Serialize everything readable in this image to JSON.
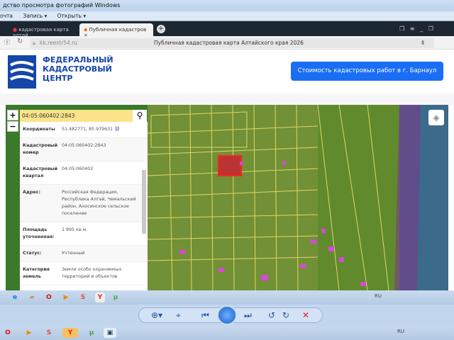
{
  "window": {
    "title": "дство просмотра фотографий Windows",
    "menu": [
      "очта",
      "Запись ▾",
      "Открыть ▾"
    ]
  },
  "browser": {
    "tabs": [
      {
        "label": "кадастровая карта алтай"
      },
      {
        "label": "Публичная кадастров"
      }
    ],
    "url": "kk.reestr54.ru",
    "page_title": "Публичная кадастровая карта Алтайского края 2026"
  },
  "site": {
    "logo_lines": [
      "ФЕДЕРАЛЬНЫЙ",
      "КАДАСТРОВЫЙ",
      "ЦЕНТР"
    ],
    "cost_button": "Стоимость кадастровых работ в г. Барнаул",
    "brand_color": "#1546a8",
    "button_color": "#1a6ef5"
  },
  "map": {
    "search_value": "04:05:060402:2843",
    "zoom_in": "+",
    "zoom_out": "−",
    "info": [
      {
        "key": "Координаты",
        "value": "51.482771, 85.979631"
      },
      {
        "key": "Кадастровый номер",
        "value": "04:05:060402:2843"
      },
      {
        "key": "Кадастровый квартал",
        "value": "04:05:060402"
      },
      {
        "key": "Адрес:",
        "value": "Российская Федерация, Республика Алтай, Чемальский район, Аносинское сельское поселение"
      },
      {
        "key": "Площадь уточненная:",
        "value": "1 895 кв.м."
      },
      {
        "key": "Статус:",
        "value": "Учтенный"
      },
      {
        "key": "Категория земель",
        "value": "Земли особо охраняемых территорий и объектов"
      }
    ]
  },
  "taskbar": {
    "language": "RU"
  }
}
